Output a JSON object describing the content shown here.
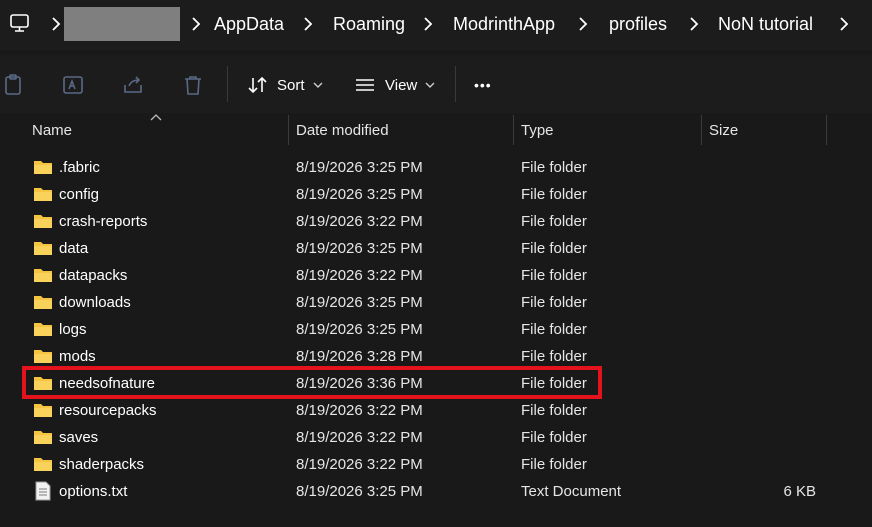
{
  "breadcrumb": [
    "AppData",
    "Roaming",
    "ModrinthApp",
    "profiles",
    "NoN tutorial"
  ],
  "toolbar": {
    "sort_label": "Sort",
    "view_label": "View",
    "more_label": "•••"
  },
  "columns": {
    "name": "Name",
    "date": "Date modified",
    "type": "Type",
    "size": "Size"
  },
  "files": [
    {
      "name": ".fabric",
      "date": "8/19/2026 3:25 PM",
      "type": "File folder",
      "size": "",
      "icon": "folder-icon"
    },
    {
      "name": "config",
      "date": "8/19/2026 3:25 PM",
      "type": "File folder",
      "size": "",
      "icon": "folder-icon"
    },
    {
      "name": "crash-reports",
      "date": "8/19/2026 3:22 PM",
      "type": "File folder",
      "size": "",
      "icon": "folder-icon"
    },
    {
      "name": "data",
      "date": "8/19/2026 3:25 PM",
      "type": "File folder",
      "size": "",
      "icon": "folder-icon"
    },
    {
      "name": "datapacks",
      "date": "8/19/2026 3:22 PM",
      "type": "File folder",
      "size": "",
      "icon": "folder-icon"
    },
    {
      "name": "downloads",
      "date": "8/19/2026 3:25 PM",
      "type": "File folder",
      "size": "",
      "icon": "folder-icon"
    },
    {
      "name": "logs",
      "date": "8/19/2026 3:25 PM",
      "type": "File folder",
      "size": "",
      "icon": "folder-icon"
    },
    {
      "name": "mods",
      "date": "8/19/2026 3:28 PM",
      "type": "File folder",
      "size": "",
      "icon": "folder-icon"
    },
    {
      "name": "needsofnature",
      "date": "8/19/2026 3:36 PM",
      "type": "File folder",
      "size": "",
      "icon": "folder-icon"
    },
    {
      "name": "resourcepacks",
      "date": "8/19/2026 3:22 PM",
      "type": "File folder",
      "size": "",
      "icon": "folder-icon"
    },
    {
      "name": "saves",
      "date": "8/19/2026 3:22 PM",
      "type": "File folder",
      "size": "",
      "icon": "folder-icon"
    },
    {
      "name": "shaderpacks",
      "date": "8/19/2026 3:22 PM",
      "type": "File folder",
      "size": "",
      "icon": "folder-icon"
    },
    {
      "name": "options.txt",
      "date": "8/19/2026 3:25 PM",
      "type": "Text Document",
      "size": "6 KB",
      "icon": "text-file-icon"
    }
  ],
  "highlighted_item": "needsofnature",
  "colors": {
    "folder": "#f5c542",
    "highlight": "#e4121b",
    "background": "#191919"
  }
}
